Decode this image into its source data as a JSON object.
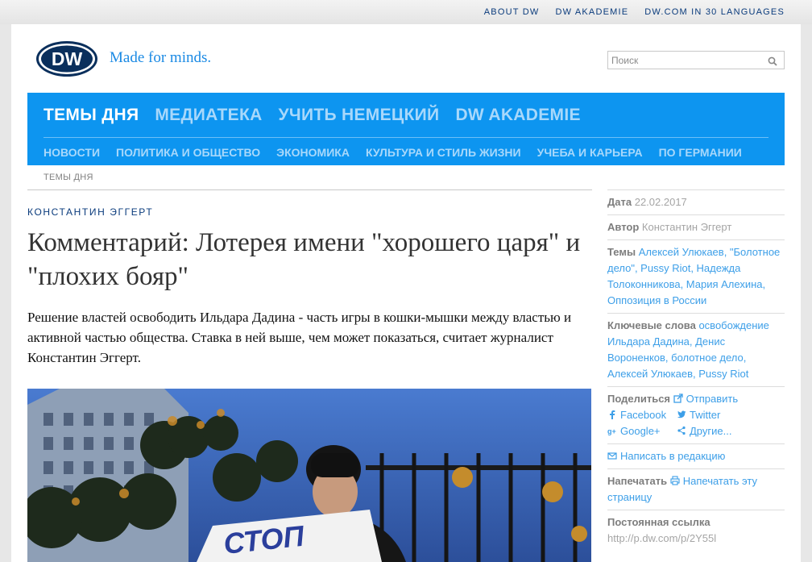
{
  "topbar": {
    "links": [
      "ABOUT DW",
      "DW AKADEMIE",
      "DW.COM IN 30 LANGUAGES"
    ]
  },
  "header": {
    "logo_text": "DW",
    "tagline": "Made for minds.",
    "search_placeholder": "Поиск"
  },
  "nav": {
    "primary": [
      "ТЕМЫ ДНЯ",
      "МЕДИАТЕКА",
      "УЧИТЬ НЕМЕЦКИЙ",
      "DW AKADEMIE"
    ],
    "secondary": [
      "НОВОСТИ",
      "ПОЛИТИКА И ОБЩЕСТВО",
      "ЭКОНОМИКА",
      "КУЛЬТУРА И СТИЛЬ ЖИЗНИ",
      "УЧЕБА И КАРЬЕРА",
      "ПО ГЕРМАНИИ"
    ]
  },
  "breadcrumb": "ТЕМЫ ДНЯ",
  "article": {
    "kicker": "КОНСТАНТИН ЭГГЕРТ",
    "headline": "Комментарий: Лотерея имени \"хорошего царя\" и \"плохих бояр\"",
    "lead": "Решение властей освободить Ильдара Дадина - часть игры в кошки-мышки между властью и активной частью общества. Ставка в ней выше, чем может показаться, считает журналист Константин Эггерт.",
    "photo_text": "СТОП"
  },
  "sidebar": {
    "date_label": "Дата",
    "date": "22.02.2017",
    "author_label": "Автор",
    "author": "Константин Эггерт",
    "topics_label": "Темы",
    "topics": "Алексей Улюкаев, \"Болотное дело\", Pussy Riot, Надежда Толоконникова, Мария Алехина, Оппозиция в России",
    "keywords_label": "Ключевые слова",
    "keywords": "освобождение Ильдара Дадина, Денис Вороненков, болотное дело, Алексей Улюкаев, Pussy Riot",
    "share_label": "Поделиться",
    "share_send": "Отправить",
    "share_facebook": "Facebook",
    "share_twitter": "Twitter",
    "share_google": "Google+",
    "share_other": "Другие...",
    "write_editor": "Написать в редакцию",
    "print_label": "Напечатать",
    "print_page": "Напечатать эту страницу",
    "permalink_label": "Постоянная ссылка",
    "permalink": "http://p.dw.com/p/2Y55l"
  },
  "colors": {
    "nav_blue": "#0d95f0",
    "link_blue": "#3d9fe8",
    "dark_blue": "#0a3b7c"
  }
}
